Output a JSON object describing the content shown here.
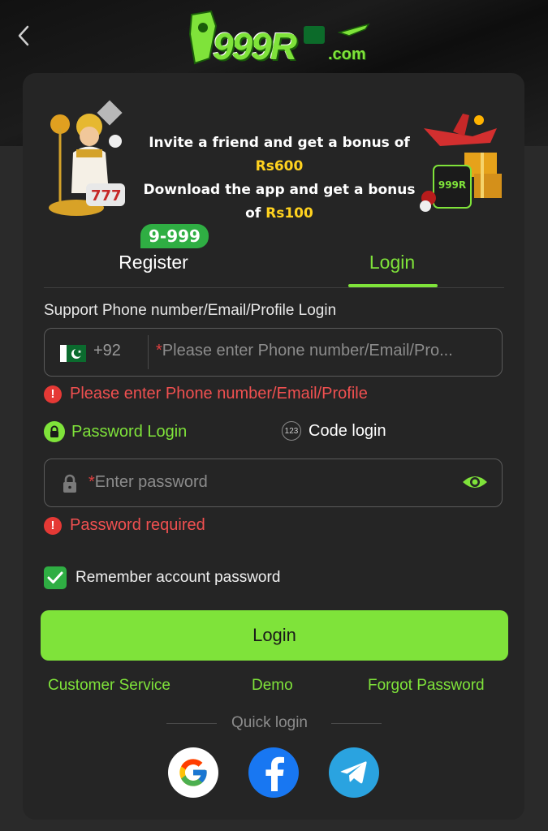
{
  "header": {
    "logo_text": "999R",
    "logo_suffix": ".com"
  },
  "banner": {
    "line1_prefix": "Invite a friend and get a bonus of ",
    "line1_amount": "Rs600",
    "line2_prefix": "Download the app and get a bonus of ",
    "line2_amount": "Rs100",
    "phone_logo": "999R"
  },
  "tabs": {
    "register_label": "Register",
    "register_badge": "9-999",
    "login_label": "Login",
    "active": "Login"
  },
  "form": {
    "account_label": "Support Phone number/Email/Profile Login",
    "country_code": "+92",
    "account_placeholder": "Please enter Phone number/Email/Pro...",
    "account_error": "Please enter Phone number/Email/Profile",
    "mode_password_label": "Password Login",
    "mode_code_label": "Code login",
    "mode_code_icon_text": "123",
    "password_placeholder": "Enter password",
    "password_error": "Password required",
    "remember_label": "Remember account password",
    "remember_checked": true,
    "submit_label": "Login"
  },
  "links": {
    "customer_service": "Customer Service",
    "demo": "Demo",
    "forgot_password": "Forgot Password"
  },
  "quick_login": {
    "label": "Quick login",
    "providers": [
      "google",
      "facebook",
      "telegram"
    ]
  },
  "colors": {
    "accent": "#7fe33a",
    "error": "#f05050",
    "card_bg": "#252525",
    "badge": "#2fae43",
    "amount": "#ffd21f"
  }
}
